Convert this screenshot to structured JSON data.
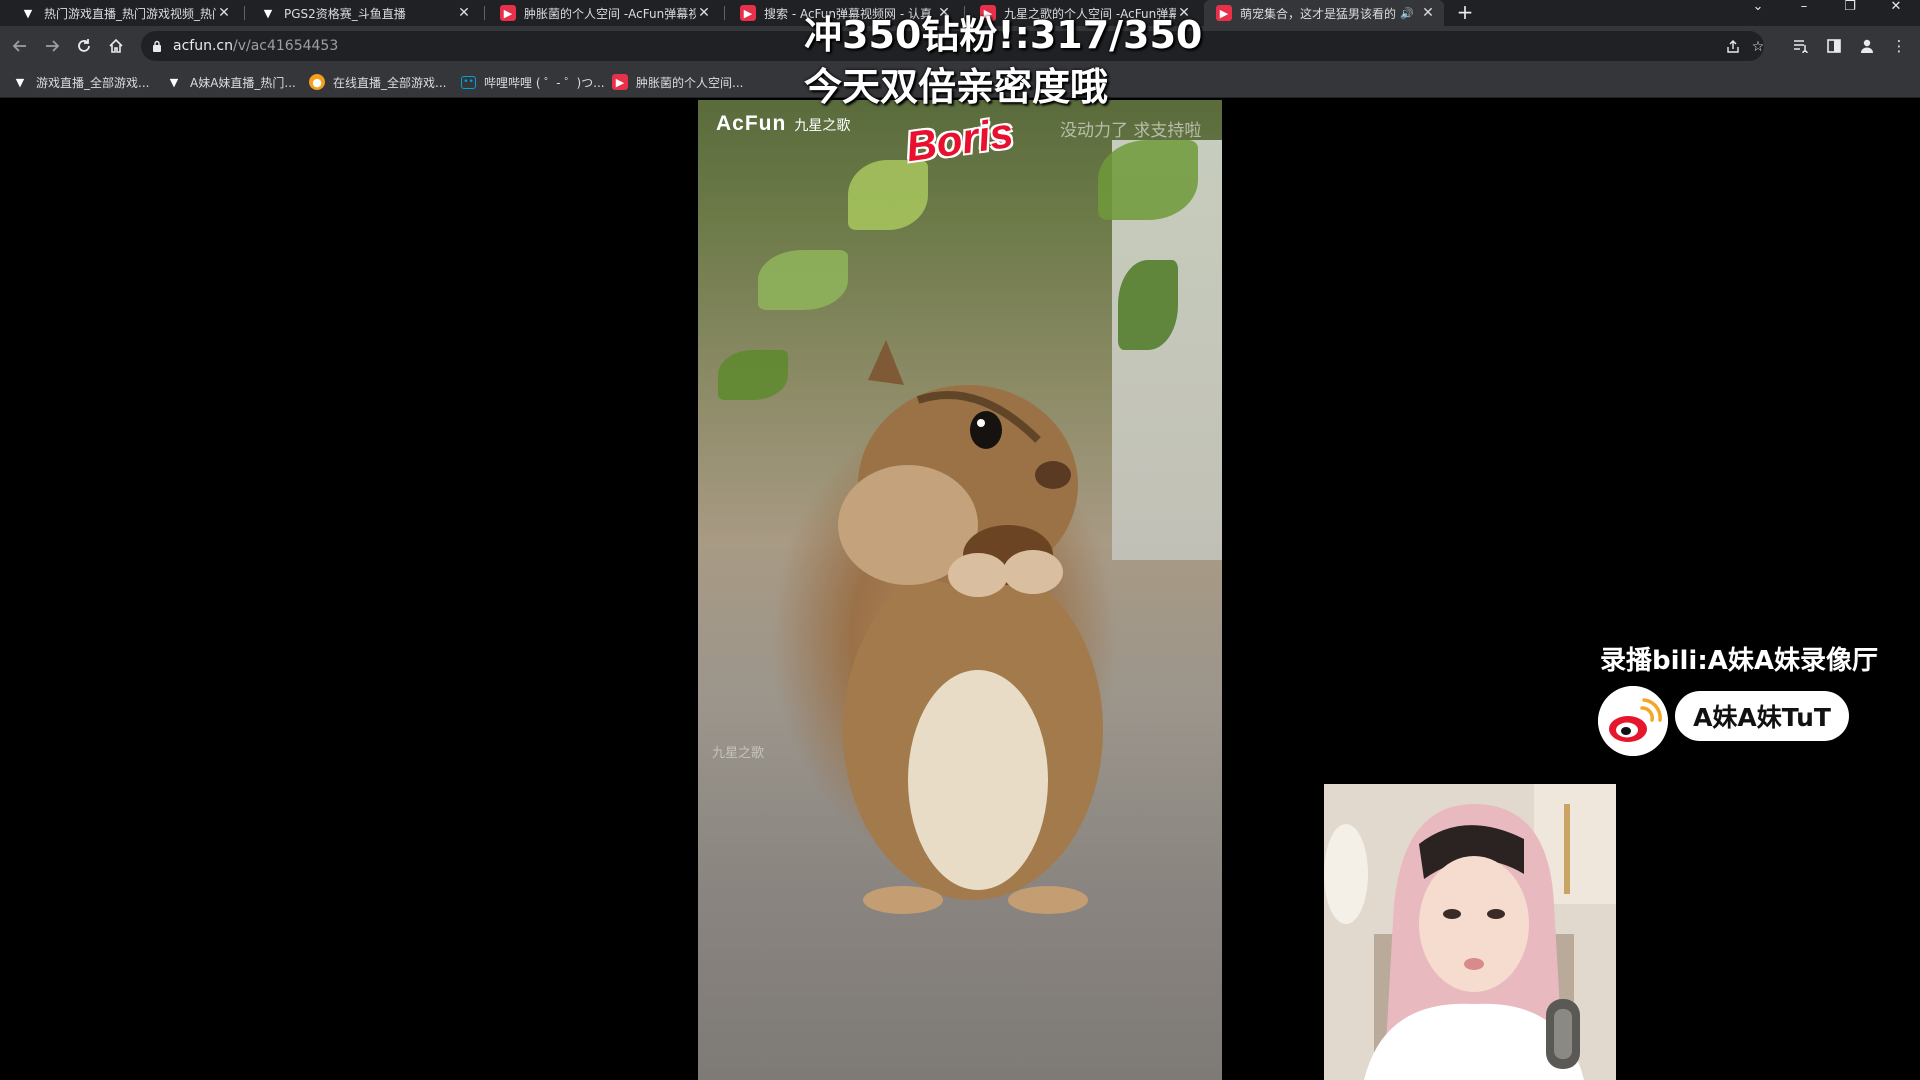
{
  "tabs": [
    {
      "title": "热门游戏直播_热门游戏视频_热门",
      "favicon": "douyu-icon",
      "active": false
    },
    {
      "title": "PGS2资格赛_斗鱼直播",
      "favicon": "douyu-icon",
      "active": false
    },
    {
      "title": "肿胀菌的个人空间 -AcFun弹幕视",
      "favicon": "acfun-icon",
      "active": false
    },
    {
      "title": "搜索 - AcFun弹幕视频网 - 认真",
      "favicon": "acfun-icon",
      "active": false
    },
    {
      "title": "九星之歌的个人空间 -AcFun弹幕",
      "favicon": "acfun-icon",
      "active": false
    },
    {
      "title": "萌宠集合，这才是猛男该看的",
      "favicon": "acfun-icon",
      "active": true,
      "audio": true
    }
  ],
  "browser": {
    "new_tab": "+",
    "url_host": "acfun.cn",
    "url_path": "/v/ac41654453",
    "accent": "#e8304a"
  },
  "bookmarks": [
    {
      "label": "游戏直播_全部游戏...",
      "icon": "douyu-icon"
    },
    {
      "label": "A妹A妹直播_热门...",
      "icon": "douyu-icon"
    },
    {
      "label": "在线直播_全部游戏...",
      "icon": "huya-icon"
    },
    {
      "label": "哔哩哔哩 ( ゜- ゜)つ...",
      "icon": "bilibili-icon"
    },
    {
      "label": "肿胀菌的个人空间...",
      "icon": "acfun-icon"
    }
  ],
  "video": {
    "brand_logo": "AcFun",
    "brand_sub": "九星之歌",
    "name_tag": "Boris",
    "corner_note": "没动力了 求支持啦",
    "watermark": "九星之歌"
  },
  "overlay": {
    "goal_line": "冲350钻粉!:317/350",
    "promo_line": "今天双倍亲密度哦",
    "record_line": "录播bili:A妹A妹录像厅",
    "weibo_name": "A妹A妹TuT"
  }
}
